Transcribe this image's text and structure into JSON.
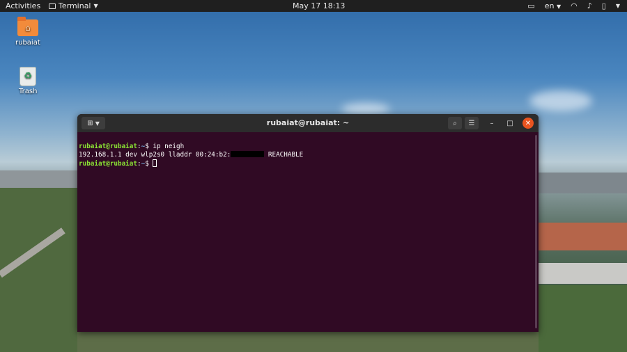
{
  "topbar": {
    "activities": "Activities",
    "app_name": "Terminal",
    "datetime": "May 17  18:13",
    "language": "en"
  },
  "desktop": {
    "icons": [
      {
        "label": "rubaiat",
        "icon": "home-folder-icon"
      },
      {
        "label": "Trash",
        "icon": "trash-icon"
      }
    ]
  },
  "terminal": {
    "title": "rubaiat@rubaiat: ~",
    "lines": [
      {
        "user": "rubaiat@rubaiat",
        "sep": ":",
        "path": "~",
        "prompt": "$ ",
        "cmd": "ip neigh"
      },
      {
        "output_before": "192.168.1.1 dev wlp2s0 lladdr 00:24:b2:",
        "output_after": " REACHABLE"
      },
      {
        "user": "rubaiat@rubaiat",
        "sep": ":",
        "path": "~",
        "prompt": "$ ",
        "cmd": ""
      }
    ]
  },
  "colors": {
    "terminal_bg": "#300a24",
    "prompt_user": "#8ae234",
    "prompt_path": "#729fcf",
    "close_button": "#e95420"
  }
}
